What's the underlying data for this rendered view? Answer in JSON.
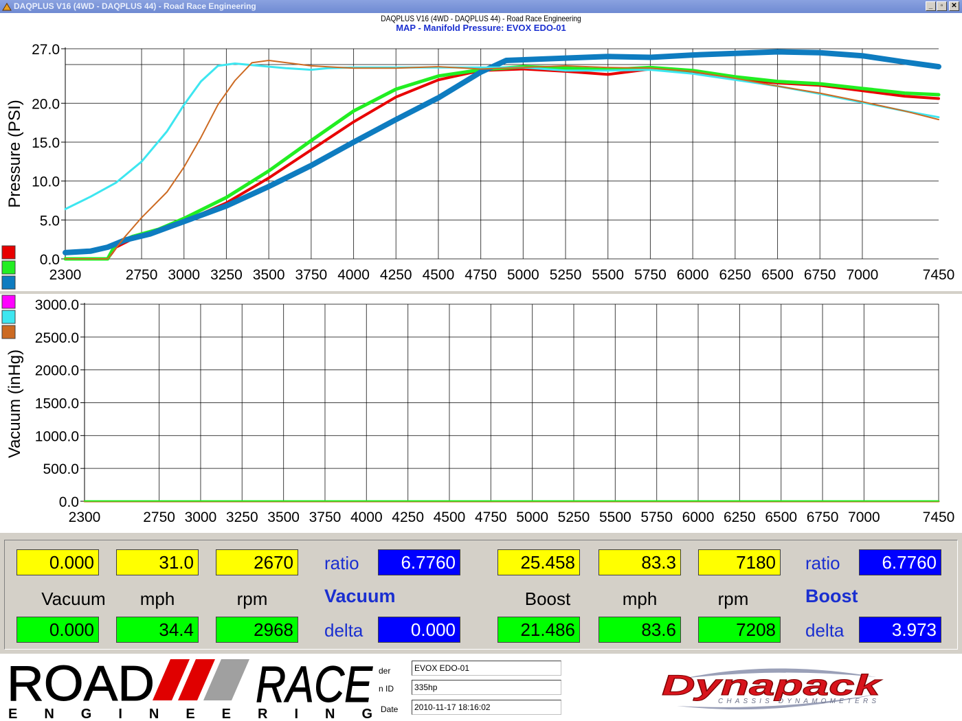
{
  "window": {
    "title": "DAQPLUS V16 (4WD - DAQPLUS 44) - Road Race Engineering",
    "buttons": [
      "_",
      "▫",
      "✕"
    ]
  },
  "header": {
    "line1": "DAQPLUS V16 (4WD - DAQPLUS 44) - Road Race Engineering",
    "line2": "MAP - Manifold Pressure: EVOX EDO-01"
  },
  "colors": {
    "red": "#e80000",
    "green": "#22ee22",
    "blue": "#0e7cc0",
    "magenta": "#ff00ff",
    "cyan": "#3de6f0",
    "orange": "#cc6a22"
  },
  "chart_data": [
    {
      "type": "line",
      "ylabel": "Pressure (PSI)",
      "xlabel": "",
      "xlim": [
        2300,
        7450
      ],
      "ylim": [
        0,
        27
      ],
      "grid": true,
      "yticks": [
        0,
        5,
        10,
        15,
        20,
        27
      ],
      "ytick_labels": [
        "0.0",
        "5.0",
        "10.0",
        "15.0",
        "20.0",
        "27.0"
      ],
      "xticks": [
        2300,
        2750,
        3000,
        3250,
        3500,
        3750,
        4000,
        4250,
        4500,
        4750,
        5000,
        5250,
        5500,
        5750,
        6000,
        6250,
        6500,
        6750,
        7000,
        7450
      ],
      "legend_swatches": [
        "red",
        "green",
        "blue"
      ],
      "series": [
        {
          "color": "red",
          "width": 4,
          "points": [
            [
              2300,
              0
            ],
            [
              2550,
              0
            ],
            [
              2600,
              1.5
            ],
            [
              2700,
              2.6
            ],
            [
              2850,
              3.5
            ],
            [
              3000,
              4.8
            ],
            [
              3250,
              7.2
            ],
            [
              3500,
              10.4
            ],
            [
              3750,
              14.0
            ],
            [
              4000,
              17.6
            ],
            [
              4250,
              20.8
            ],
            [
              4500,
              23.0
            ],
            [
              4750,
              24.2
            ],
            [
              5000,
              24.4
            ],
            [
              5250,
              24.1
            ],
            [
              5500,
              23.7
            ],
            [
              5750,
              24.4
            ],
            [
              6000,
              24.1
            ],
            [
              6250,
              23.1
            ],
            [
              6500,
              22.6
            ],
            [
              6750,
              22.3
            ],
            [
              7000,
              21.6
            ],
            [
              7250,
              20.9
            ],
            [
              7450,
              20.6
            ]
          ]
        },
        {
          "color": "green",
          "width": 5,
          "points": [
            [
              2300,
              0
            ],
            [
              2550,
              0
            ],
            [
              2600,
              2.0
            ],
            [
              2700,
              2.9
            ],
            [
              2850,
              3.8
            ],
            [
              3000,
              5.2
            ],
            [
              3250,
              7.9
            ],
            [
              3500,
              11.3
            ],
            [
              3750,
              15.2
            ],
            [
              4000,
              19.0
            ],
            [
              4250,
              21.8
            ],
            [
              4500,
              23.5
            ],
            [
              4750,
              24.3
            ],
            [
              5000,
              24.7
            ],
            [
              5250,
              24.5
            ],
            [
              5500,
              24.3
            ],
            [
              5750,
              24.6
            ],
            [
              6000,
              24.2
            ],
            [
              6250,
              23.4
            ],
            [
              6500,
              22.8
            ],
            [
              6750,
              22.5
            ],
            [
              7000,
              21.9
            ],
            [
              7250,
              21.3
            ],
            [
              7450,
              21.1
            ]
          ]
        },
        {
          "color": "blue",
          "width": 8,
          "points": [
            [
              2300,
              0.8
            ],
            [
              2450,
              1.0
            ],
            [
              2550,
              1.5
            ],
            [
              2650,
              2.4
            ],
            [
              2800,
              3.2
            ],
            [
              3000,
              4.8
            ],
            [
              3250,
              6.8
            ],
            [
              3500,
              9.3
            ],
            [
              3750,
              12.0
            ],
            [
              4000,
              15.0
            ],
            [
              4250,
              17.9
            ],
            [
              4500,
              20.7
            ],
            [
              4750,
              24.0
            ],
            [
              4900,
              25.5
            ],
            [
              5250,
              25.8
            ],
            [
              5500,
              26.0
            ],
            [
              5750,
              25.9
            ],
            [
              6000,
              26.2
            ],
            [
              6250,
              26.4
            ],
            [
              6500,
              26.6
            ],
            [
              6750,
              26.5
            ],
            [
              7000,
              26.1
            ],
            [
              7250,
              25.3
            ],
            [
              7450,
              24.7
            ]
          ]
        },
        {
          "color": "cyan",
          "width": 3,
          "points": [
            [
              2300,
              6.4
            ],
            [
              2450,
              8.0
            ],
            [
              2600,
              9.8
            ],
            [
              2750,
              12.5
            ],
            [
              2900,
              16.4
            ],
            [
              3000,
              19.8
            ],
            [
              3100,
              22.8
            ],
            [
              3200,
              24.8
            ],
            [
              3300,
              25.1
            ],
            [
              3450,
              24.8
            ],
            [
              3600,
              24.5
            ],
            [
              3750,
              24.3
            ],
            [
              3850,
              24.5
            ],
            [
              4000,
              24.6
            ],
            [
              4250,
              24.6
            ],
            [
              4500,
              24.6
            ],
            [
              4750,
              24.6
            ],
            [
              5000,
              24.6
            ],
            [
              5250,
              24.2
            ],
            [
              5500,
              24.2
            ],
            [
              5750,
              24.3
            ],
            [
              6000,
              23.8
            ],
            [
              6250,
              23.0
            ],
            [
              6500,
              22.2
            ],
            [
              6750,
              21.2
            ],
            [
              7000,
              20.1
            ],
            [
              7250,
              19.0
            ],
            [
              7450,
              18.2
            ]
          ]
        },
        {
          "color": "orange",
          "width": 2,
          "points": [
            [
              2300,
              0
            ],
            [
              2550,
              0
            ],
            [
              2650,
              2.8
            ],
            [
              2750,
              5.3
            ],
            [
              2900,
              8.6
            ],
            [
              3000,
              11.8
            ],
            [
              3100,
              15.6
            ],
            [
              3200,
              19.8
            ],
            [
              3300,
              22.9
            ],
            [
              3400,
              25.2
            ],
            [
              3500,
              25.5
            ],
            [
              3750,
              24.8
            ],
            [
              4000,
              24.5
            ],
            [
              4250,
              24.5
            ],
            [
              4500,
              24.7
            ],
            [
              4750,
              24.4
            ],
            [
              5000,
              24.6
            ],
            [
              5250,
              24.8
            ],
            [
              5500,
              24.6
            ],
            [
              5750,
              24.5
            ],
            [
              6000,
              24.1
            ],
            [
              6250,
              23.2
            ],
            [
              6500,
              22.2
            ],
            [
              6750,
              21.3
            ],
            [
              7000,
              20.2
            ],
            [
              7250,
              19.0
            ],
            [
              7450,
              17.9
            ]
          ]
        }
      ]
    },
    {
      "type": "line",
      "ylabel": "Vacuum (inHg)",
      "xlabel": "",
      "xlim": [
        2300,
        7450
      ],
      "ylim": [
        0,
        3000
      ],
      "grid": true,
      "yticks": [
        0,
        500,
        1000,
        1500,
        2000,
        2500,
        3000
      ],
      "ytick_labels": [
        "0.0",
        "500.0",
        "1000.0",
        "1500.0",
        "2000.0",
        "2500.0",
        "3000.0"
      ],
      "xticks": [
        2300,
        2750,
        3000,
        3250,
        3500,
        3750,
        4000,
        4250,
        4500,
        4750,
        5000,
        5250,
        5500,
        5750,
        6000,
        6250,
        6500,
        6750,
        7000,
        7450
      ],
      "legend_swatches": [
        "magenta",
        "cyan",
        "orange"
      ],
      "series": [
        {
          "color": "orange",
          "width": 3,
          "points": [
            [
              2300,
              0
            ],
            [
              7450,
              0
            ]
          ]
        },
        {
          "color": "green",
          "width": 2,
          "points": [
            [
              2300,
              5
            ],
            [
              7450,
              5
            ]
          ]
        }
      ]
    }
  ],
  "readouts": {
    "vacuum_group": {
      "row1": [
        "0.000",
        "31.0",
        "2670"
      ],
      "labels": [
        "Vacuum",
        "mph",
        "rpm"
      ],
      "row2": [
        "0.000",
        "34.4",
        "2968"
      ],
      "ratio_label": "ratio",
      "ratio_value": "6.7760",
      "title": "Vacuum",
      "delta_label": "delta",
      "delta_value": "0.000"
    },
    "boost_group": {
      "row1": [
        "25.458",
        "83.3",
        "7180"
      ],
      "labels": [
        "Boost",
        "mph",
        "rpm"
      ],
      "row2": [
        "21.486",
        "83.6",
        "7208"
      ],
      "ratio_label": "ratio",
      "ratio_value": "6.7760",
      "title": "Boost",
      "delta_label": "delta",
      "delta_value": "3.973"
    }
  },
  "footer": {
    "logo_left_top": "ROAD",
    "logo_left_right": "RACE",
    "logo_left_bottom": "E N G I N E E R I N G",
    "info": [
      {
        "label": "der",
        "value": "EVOX EDO-01"
      },
      {
        "label": "n ID",
        "value": "335hp"
      },
      {
        "label": "Date",
        "value": "2010-11-17 18:16:02"
      }
    ],
    "logo_right": "Dynapack",
    "logo_right_sub": "CHASSIS DYNAMOMETERS"
  }
}
